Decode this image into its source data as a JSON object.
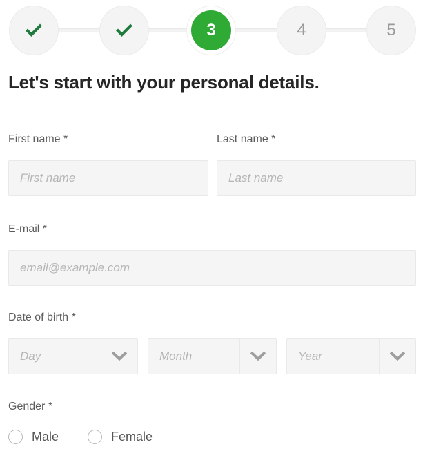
{
  "colors": {
    "accent_green": "#2eaa35",
    "check_green": "#1f7a3d",
    "heading": "#262626",
    "label": "#5c5c5c",
    "placeholder": "#b6b6b6",
    "field_bg": "#f5f5f5",
    "field_border": "#e9e9e9",
    "step_bg": "#f4f4f4",
    "step_number": "#9a9a9a"
  },
  "stepper": {
    "steps": [
      {
        "id": "step1",
        "label": "✔",
        "state": "done",
        "icon": "check-icon"
      },
      {
        "id": "step2",
        "label": "✔",
        "state": "done",
        "icon": "check-icon"
      },
      {
        "id": "step3",
        "label": "3",
        "state": "active",
        "icon": ""
      },
      {
        "id": "step4",
        "label": "4",
        "state": "pending",
        "icon": ""
      },
      {
        "id": "step5",
        "label": "5",
        "state": "pending",
        "icon": ""
      }
    ],
    "current_step": 3,
    "total_steps": 5
  },
  "heading": "Let's start with your personal details.",
  "form": {
    "first_name": {
      "label": "First name *",
      "placeholder": "First name",
      "value": ""
    },
    "last_name": {
      "label": "Last name *",
      "placeholder": "Last name",
      "value": ""
    },
    "email": {
      "label": "E-mail *",
      "placeholder": "email@example.com",
      "value": ""
    },
    "date_of_birth": {
      "label": "Date of birth *",
      "day": {
        "selected": "Day",
        "options": [
          "Day"
        ]
      },
      "month": {
        "selected": "Month",
        "options": [
          "Month"
        ]
      },
      "year": {
        "selected": "Year",
        "options": [
          "Year"
        ]
      },
      "arrow_icon": "chevron-down-icon"
    },
    "gender": {
      "label": "Gender *",
      "options": [
        {
          "label": "Male",
          "selected": false
        },
        {
          "label": "Female",
          "selected": false
        }
      ]
    }
  }
}
